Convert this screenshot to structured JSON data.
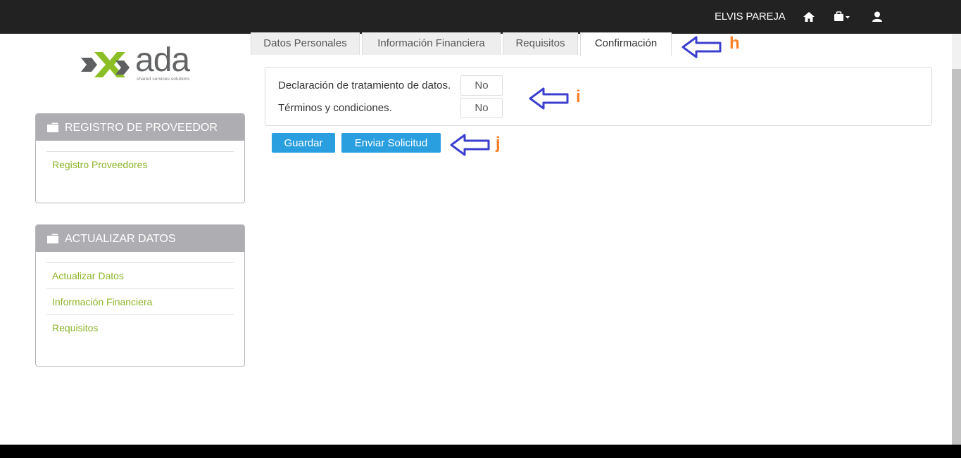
{
  "navbar": {
    "user_name": "ELVIS PAREJA",
    "icons": [
      "home-icon",
      "briefcase-dropdown-icon",
      "user-icon"
    ],
    "background_color": "#222222"
  },
  "logo": {
    "text": "ada",
    "tagline": "shared services solutions"
  },
  "sidebar": {
    "panels": [
      {
        "title": "REGISTRO DE PROVEEDOR",
        "icon": "folder-icon",
        "links": [
          "Registro Proveedores"
        ]
      },
      {
        "title": "ACTUALIZAR DATOS",
        "icon": "folder-icon",
        "links": [
          "Actualizar Datos",
          "Información Financiera",
          "Requisitos"
        ]
      }
    ],
    "link_color": "#8cb529",
    "header_color": "#aeaeb2"
  },
  "tabs": [
    {
      "label": "Datos Personales",
      "active": false
    },
    {
      "label": "Información Financiera",
      "active": false
    },
    {
      "label": "Requisitos",
      "active": false
    },
    {
      "label": "Confirmación",
      "active": true
    }
  ],
  "confirmation": {
    "rows": [
      {
        "label": "Declaración de tratamiento de datos.",
        "value": "No"
      },
      {
        "label": "Términos y condiciones.",
        "value": "No"
      }
    ]
  },
  "actions": {
    "save_label": "Guardar",
    "submit_label": "Enviar Solicitud",
    "button_color": "#2a9fe0"
  },
  "annotations": {
    "labels": [
      "h",
      "i",
      "j"
    ],
    "arrow_color": "#3b3fcf",
    "label_color": "#ff7f27"
  }
}
